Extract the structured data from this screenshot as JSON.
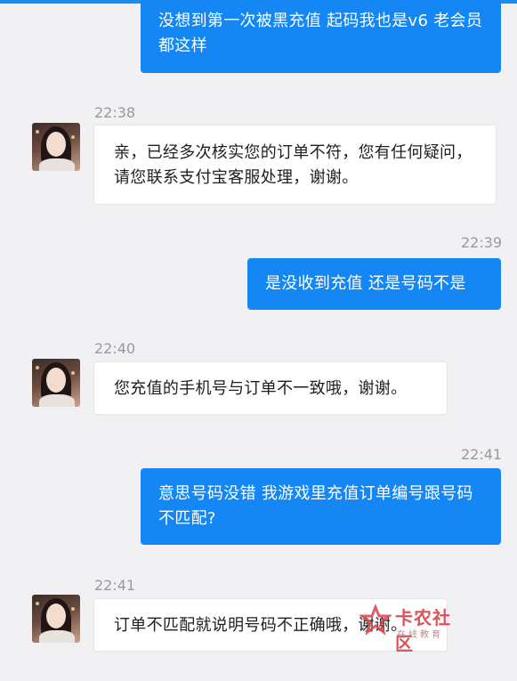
{
  "messages": [
    {
      "direction": "out",
      "text": "没想到第一次被黑充值 起码我也是v6 老会员都这样"
    },
    {
      "direction": "in",
      "time": "22:38",
      "text": "亲，已经多次核实您的订单不符，您有任何疑问，请您联系支付宝客服处理，谢谢。"
    },
    {
      "direction": "out",
      "time": "22:39",
      "text": "是没收到充值 还是号码不是"
    },
    {
      "direction": "in",
      "time": "22:40",
      "text": "您充值的手机号与订单不一致哦，谢谢。"
    },
    {
      "direction": "out",
      "time": "22:41",
      "text": "意思号码没错 我游戏里充值订单编号跟号码不匹配?"
    },
    {
      "direction": "in",
      "time": "22:41",
      "text": "订单不匹配就说明号码不正确哦，谢谢。"
    }
  ],
  "watermark": {
    "title": "卡农社区",
    "subtitle": "在线教育"
  },
  "colors": {
    "outgoing_bubble": "#1487f4",
    "incoming_bubble": "#ffffff",
    "background": "#f1f1f3",
    "timestamp": "#9a9a9e"
  }
}
